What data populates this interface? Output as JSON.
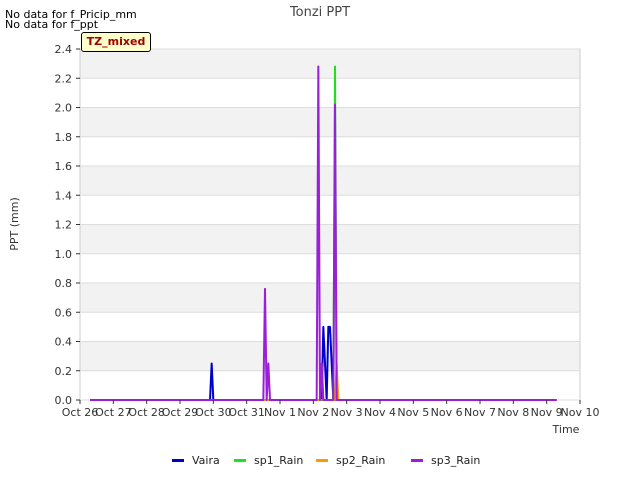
{
  "notices": [
    "No data for f_Pricip_mm",
    "No data for f_ppt"
  ],
  "tz_label": "TZ_mixed",
  "chart_data": {
    "type": "line",
    "title": "Tonzi PPT",
    "xlabel": "Time",
    "ylabel": "PPT (mm)",
    "ylim": [
      0,
      2.4
    ],
    "yticks": [
      "0.0",
      "0.2",
      "0.4",
      "0.6",
      "0.8",
      "1.0",
      "1.2",
      "1.4",
      "1.6",
      "1.8",
      "2.0",
      "2.2",
      "2.4"
    ],
    "xlim": [
      0,
      15
    ],
    "xticks": [
      "Oct 26",
      "Oct 27",
      "Oct 28",
      "Oct 29",
      "Oct 30",
      "Oct 31",
      "Nov 1",
      "Nov 2",
      "Nov 3",
      "Nov 4",
      "Nov 5",
      "Nov 6",
      "Nov 7",
      "Nov 8",
      "Nov 9",
      "Nov 10"
    ],
    "grid": true,
    "legend_position": "bottom-center",
    "series": [
      {
        "name": "Vaira",
        "color": "#0000cc",
        "x": [
          0.3,
          3.9,
          3.95,
          4.0,
          7.25,
          7.3,
          7.4,
          7.45,
          7.5,
          7.6,
          7.65,
          14.3
        ],
        "y": [
          0,
          0,
          0.25,
          0,
          0,
          0.5,
          0,
          0.5,
          0.5,
          0,
          0,
          0
        ]
      },
      {
        "name": "sp1_Rain",
        "color": "#22dd22",
        "x": [
          0.3,
          7.6,
          7.65,
          7.7,
          14.3
        ],
        "y": [
          0,
          0,
          2.28,
          0,
          0
        ]
      },
      {
        "name": "sp2_Rain",
        "color": "#ff9900",
        "x": [
          0.3,
          7.2,
          7.25,
          7.3,
          7.65,
          7.7,
          7.75,
          14.3
        ],
        "y": [
          0,
          0,
          0.25,
          0,
          0,
          0.25,
          0,
          0
        ]
      },
      {
        "name": "sp3_Rain",
        "color": "#9b1fd8",
        "x": [
          0.3,
          5.5,
          5.55,
          5.6,
          5.65,
          5.7,
          7.1,
          7.15,
          7.2,
          7.25,
          7.3,
          7.6,
          7.65,
          7.7,
          14.3
        ],
        "y": [
          0,
          0,
          0.76,
          0,
          0.25,
          0,
          0,
          2.28,
          0,
          0.25,
          0,
          0,
          2.02,
          0,
          0
        ]
      }
    ]
  }
}
